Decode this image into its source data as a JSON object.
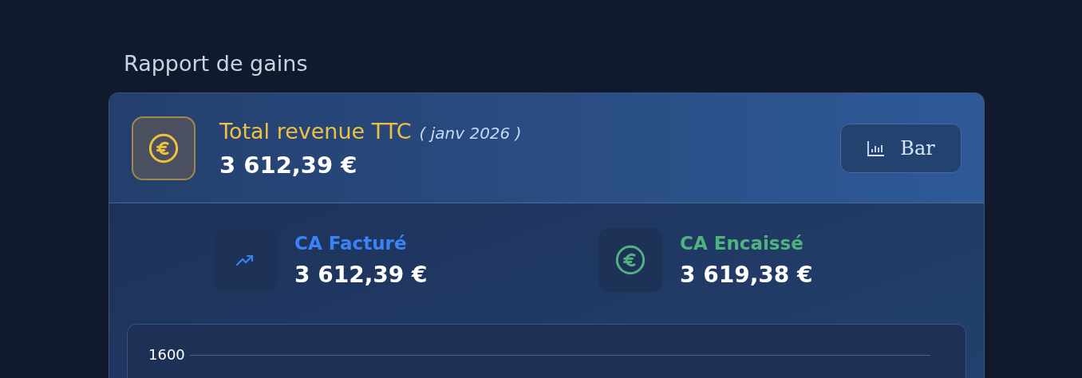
{
  "section_title": "Rapport de gains",
  "summary": {
    "title": "Total revenue TTC",
    "period": "( janv 2026 )",
    "amount": "3 612,39 €"
  },
  "view_button": {
    "label": "Bar"
  },
  "stats": [
    {
      "kind": "trend",
      "label": "CA Facturé",
      "value": "3 612,39 €",
      "color": "#3b82f6"
    },
    {
      "kind": "euro",
      "label": "CA Encaissé",
      "value": "3 619,38 €",
      "color": "#4fb37f"
    }
  ],
  "chart": {
    "y_tick_labels": [
      "1600"
    ]
  }
}
